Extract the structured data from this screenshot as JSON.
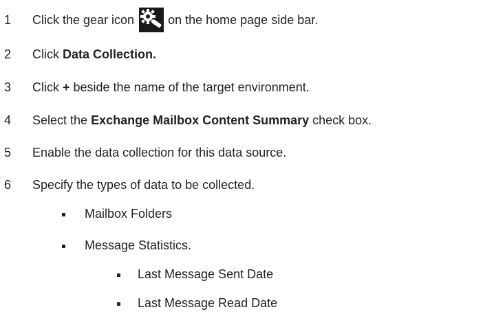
{
  "steps": [
    {
      "num": "1",
      "pre": "Click the gear icon",
      "post": "on the home page side bar.",
      "icon": "gear-icon"
    },
    {
      "num": "2",
      "pre": "Click ",
      "bold": "Data Collection."
    },
    {
      "num": "3",
      "pre": "Click ",
      "bold": "+",
      "post": " beside the name of the target environment."
    },
    {
      "num": "4",
      "pre": "Select the ",
      "bold": "Exchange Mailbox Content Summary",
      "post": " check box."
    },
    {
      "num": "5",
      "pre": "Enable the data collection for this data source."
    },
    {
      "num": "6",
      "pre": "Specify the types of data to be collected."
    }
  ],
  "bullets": {
    "level1": [
      "Mailbox Folders",
      "Message Statistics."
    ],
    "level2": [
      "Last Message Sent Date",
      "Last Message Read Date"
    ]
  }
}
